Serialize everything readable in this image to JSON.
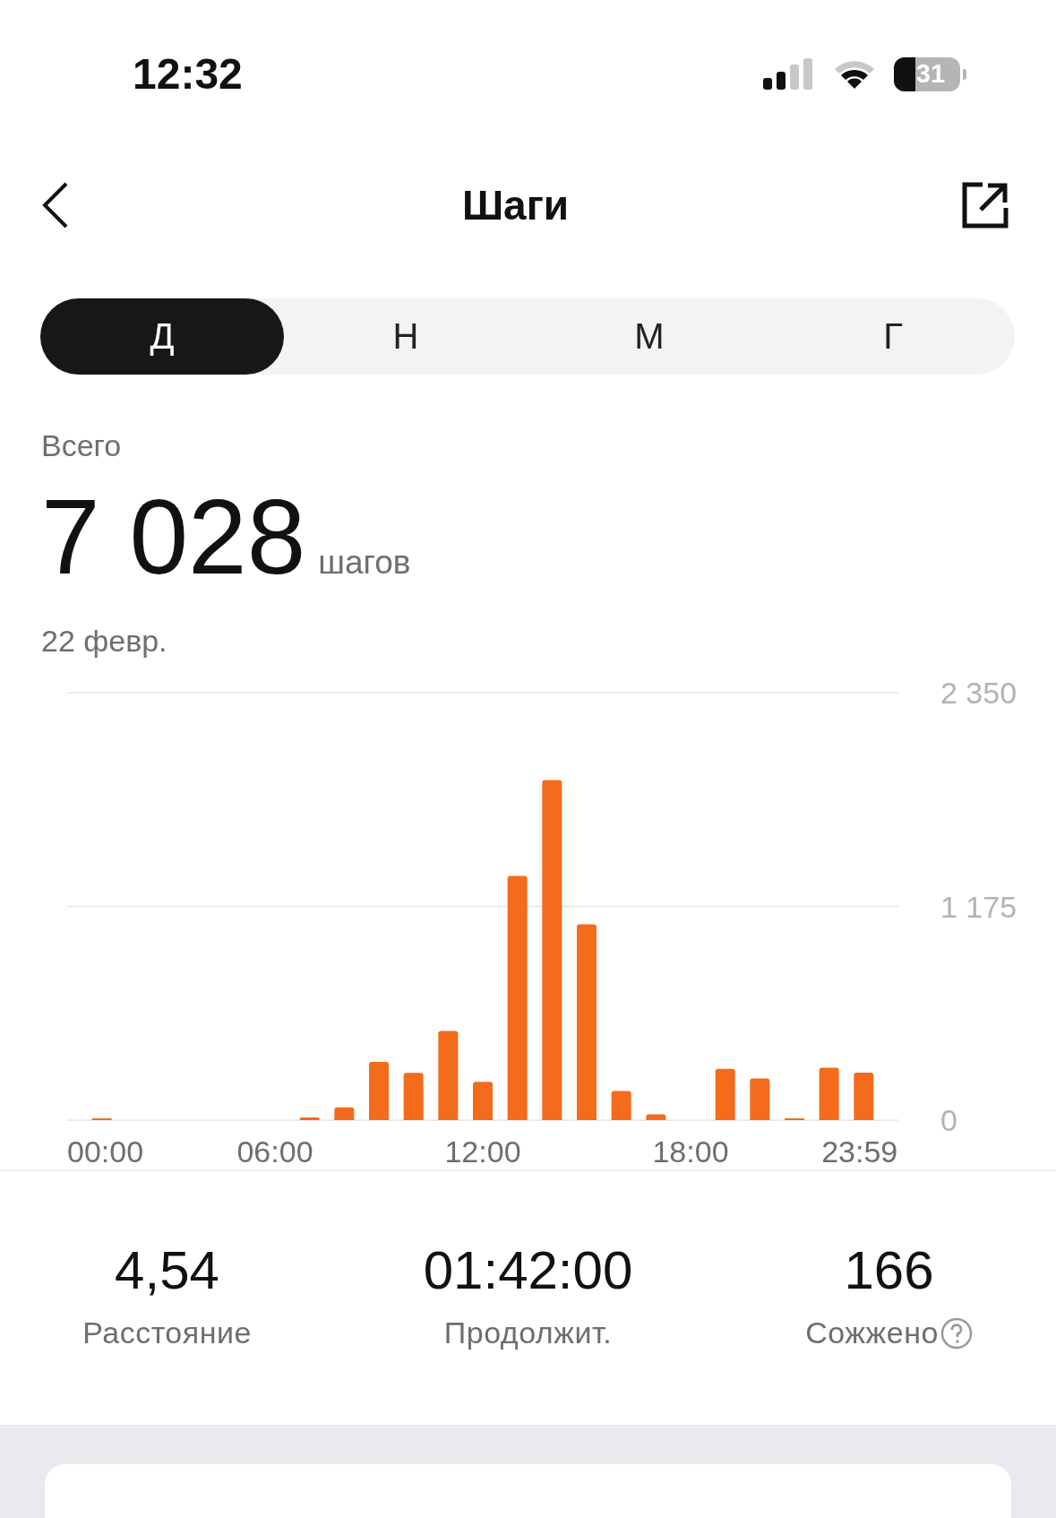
{
  "status_bar": {
    "time": "12:32",
    "battery": "31"
  },
  "header": {
    "title": "Шаги"
  },
  "tabs": [
    {
      "label": "Д",
      "selected": true
    },
    {
      "label": "Н",
      "selected": false
    },
    {
      "label": "М",
      "selected": false
    },
    {
      "label": "Г",
      "selected": false
    }
  ],
  "summary": {
    "label": "Всего",
    "value": "7 028",
    "unit": "шагов",
    "date": "22 февр."
  },
  "chart_data": {
    "type": "bar",
    "x": [
      1,
      2,
      3,
      4,
      5,
      6,
      7,
      8,
      9,
      10,
      11,
      12,
      13,
      14,
      15,
      16,
      17,
      18,
      19,
      20,
      21,
      22,
      23,
      24
    ],
    "values": [
      5,
      0,
      0,
      0,
      0,
      0,
      15,
      70,
      320,
      260,
      490,
      210,
      1343,
      1870,
      1076,
      160,
      32,
      0,
      282,
      229,
      10,
      288,
      261,
      0
    ],
    "xlim": [
      0,
      24
    ],
    "ylim": [
      0,
      2350
    ],
    "xticks": [
      {
        "value": 0,
        "label": "00:00"
      },
      {
        "value": 6,
        "label": "06:00"
      },
      {
        "value": 12,
        "label": "12:00"
      },
      {
        "value": 18,
        "label": "18:00"
      },
      {
        "value": 23.98,
        "label": "23:59"
      }
    ],
    "yticks": [
      {
        "value": 0,
        "label": "0"
      },
      {
        "value": 1175,
        "label": "1 175"
      },
      {
        "value": 2350,
        "label": "2 350"
      }
    ]
  },
  "stats": [
    {
      "value": "4,54",
      "label": "Расстояние",
      "help": false
    },
    {
      "value": "01:42:00",
      "label": "Продолжит.",
      "help": false
    },
    {
      "value": "166",
      "label": "Сожжено",
      "help": true
    }
  ]
}
